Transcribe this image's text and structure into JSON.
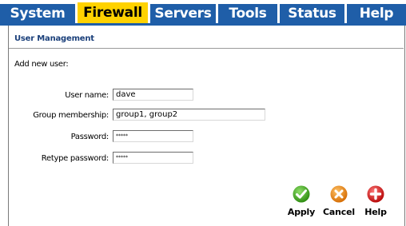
{
  "nav": {
    "tabs": [
      {
        "label": "System"
      },
      {
        "label": "Firewall",
        "active": true
      },
      {
        "label": "Servers"
      },
      {
        "label": "Tools"
      },
      {
        "label": "Status"
      },
      {
        "label": "Help"
      }
    ]
  },
  "section": {
    "title": "User Management",
    "subtitle": "Add new user:"
  },
  "form": {
    "username_label": "User name:",
    "username_value": "dave",
    "group_label": "Group membership:",
    "group_value": "group1, group2",
    "password_label": "Password:",
    "password_value": "*****",
    "retype_label": "Retype password:",
    "retype_value": "*****"
  },
  "actions": {
    "apply_label": "Apply",
    "cancel_label": "Cancel",
    "help_label": "Help"
  },
  "colors": {
    "tab_blue": "#1f5ea8",
    "tab_active": "#ffd200",
    "apply_green": "#4caf2a",
    "cancel_orange": "#e88a1a",
    "help_red": "#d01818"
  },
  "icons": {
    "apply": "check-icon",
    "cancel": "x-icon",
    "help": "plus-icon"
  }
}
